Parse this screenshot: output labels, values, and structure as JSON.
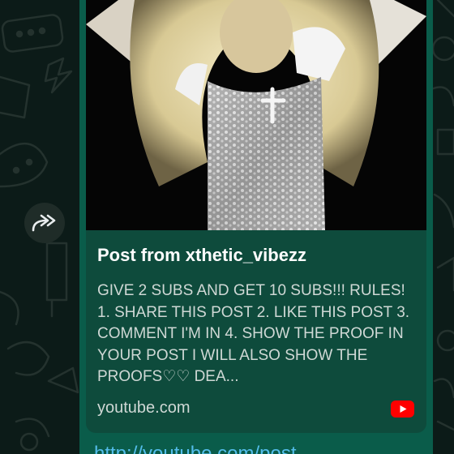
{
  "message": {
    "preview": {
      "title": "Post from xthetic_vibezz",
      "description": "GIVE 2 SUBS AND GET 10 SUBS!!! RULES! 1. SHARE THIS POST 2. LIKE THIS POST 3. COMMENT I'M IN 4. SHOW THE PROOF IN YOUR POST I WILL ALSO SHOW THE PROOFS♡♡ DEA...",
      "domain": "youtube.com",
      "source_icon": "youtube-icon"
    },
    "link": "http://youtube.com/post"
  },
  "controls": {
    "forward_icon": "forward-icon"
  },
  "colors": {
    "bubble": "#0a5c4a",
    "card": "#0e4b3c",
    "link": "#53bdeb",
    "background": "#0c1b18",
    "youtube_red": "#ff0000"
  }
}
